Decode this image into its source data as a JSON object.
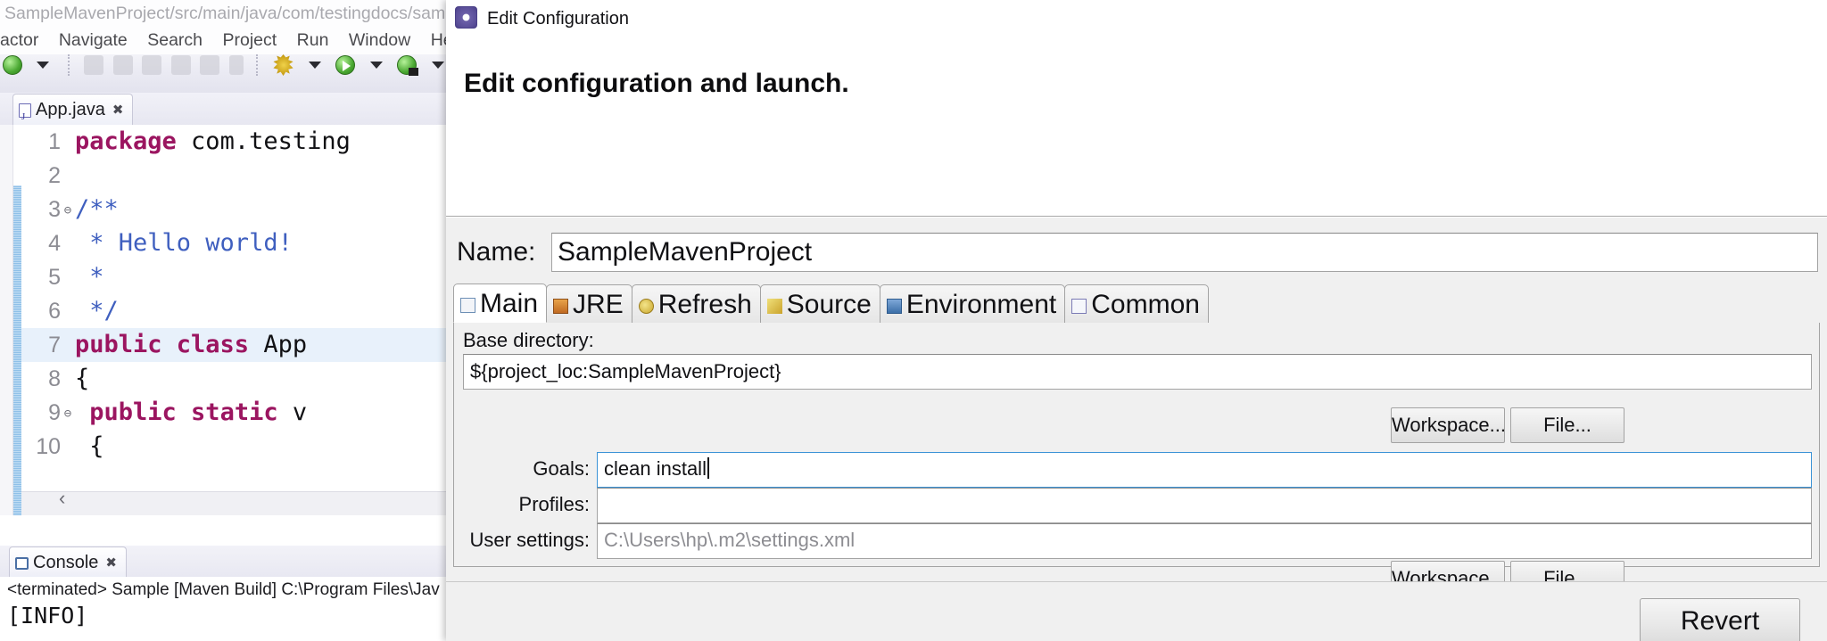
{
  "ide": {
    "title": "SampleMavenProject/src/main/java/com/testingdocs/sam",
    "menus": [
      "actor",
      "Navigate",
      "Search",
      "Project",
      "Run",
      "Window",
      "Help"
    ],
    "toolbar_icons": [
      "new-wizard-icon",
      "new-wizard-dropdown-icon",
      "save-icon",
      "quick-access-icon",
      "link-icon",
      "open-type-icon",
      "open-task-icon",
      "pilcrow-icon",
      "debug-icon",
      "debug-dropdown-icon",
      "run-icon",
      "run-dropdown-icon",
      "coverage-icon",
      "coverage-dropdown-icon",
      "external-tools-icon",
      "external-tools-dropdown-icon",
      "open-folder-icon",
      "open-resource-icon",
      "pencil-icon"
    ],
    "editor": {
      "tab_label": "App.java",
      "tab_icon": "java-file-icon",
      "close_icon": "close-icon",
      "lines": [
        {
          "num": "1",
          "fold": "",
          "highlight": false,
          "tokens": [
            {
              "t": "package",
              "c": "kw"
            },
            {
              "t": " com.testing",
              "c": "pl"
            }
          ]
        },
        {
          "num": "2",
          "fold": "",
          "highlight": false,
          "tokens": []
        },
        {
          "num": "3",
          "fold": "⊖",
          "highlight": false,
          "tokens": [
            {
              "t": "/**",
              "c": "cm"
            }
          ]
        },
        {
          "num": "4",
          "fold": "",
          "highlight": false,
          "tokens": [
            {
              "t": " * Hello world!",
              "c": "cm"
            }
          ]
        },
        {
          "num": "5",
          "fold": "",
          "highlight": false,
          "tokens": [
            {
              "t": " *",
              "c": "cm"
            }
          ]
        },
        {
          "num": "6",
          "fold": "",
          "highlight": false,
          "tokens": [
            {
              "t": " */",
              "c": "cm"
            }
          ]
        },
        {
          "num": "7",
          "fold": "",
          "highlight": true,
          "tokens": [
            {
              "t": "public class",
              "c": "kw"
            },
            {
              "t": " App",
              "c": "pl"
            }
          ]
        },
        {
          "num": "8",
          "fold": "",
          "highlight": false,
          "tokens": [
            {
              "t": "{",
              "c": "pl"
            }
          ]
        },
        {
          "num": "9",
          "fold": "⊖",
          "highlight": false,
          "tokens": [
            {
              "t": "    ",
              "c": "pl"
            },
            {
              "t": "public static",
              "c": "kw"
            },
            {
              "t": " v",
              "c": "pl"
            }
          ]
        },
        {
          "num": "10",
          "fold": "",
          "highlight": false,
          "tokens": [
            {
              "t": "    {",
              "c": "pl"
            }
          ]
        }
      ]
    },
    "console": {
      "tab_label": "Console",
      "tab_icon": "console-icon",
      "close_icon": "close-icon",
      "header": "<terminated> Sample [Maven Build] C:\\Program Files\\Jav",
      "first_line": "[INFO]"
    }
  },
  "dialog": {
    "title": "Edit Configuration",
    "title_icon": "launch-configuration-icon",
    "heading": "Edit configuration and launch.",
    "name": {
      "label": "Name:",
      "value": "SampleMavenProject"
    },
    "tabs": [
      {
        "label": "Main",
        "icon": "main-tab-icon",
        "icon_class": "di-main",
        "selected": true
      },
      {
        "label": "JRE",
        "icon": "jre-tab-icon",
        "icon_class": "di-jre",
        "selected": false
      },
      {
        "label": "Refresh",
        "icon": "refresh-tab-icon",
        "icon_class": "di-refresh",
        "selected": false
      },
      {
        "label": "Source",
        "icon": "source-tab-icon",
        "icon_class": "di-source",
        "selected": false
      },
      {
        "label": "Environment",
        "icon": "environment-tab-icon",
        "icon_class": "di-env",
        "selected": false
      },
      {
        "label": "Common",
        "icon": "common-tab-icon",
        "icon_class": "di-common",
        "selected": false
      }
    ],
    "main_tab": {
      "base_directory": {
        "label": "Base directory:",
        "value": "${project_loc:SampleMavenProject}"
      },
      "goals": {
        "label": "Goals:",
        "value": "clean install",
        "focused": true
      },
      "profiles": {
        "label": "Profiles:",
        "value": ""
      },
      "user_settings": {
        "label": "User settings:",
        "value": "C:\\Users\\hp\\.m2\\settings.xml",
        "is_placeholder": true
      },
      "buttons": {
        "workspace": "Workspace...",
        "file": "File..."
      }
    },
    "footer": {
      "revert": "Revert"
    }
  }
}
